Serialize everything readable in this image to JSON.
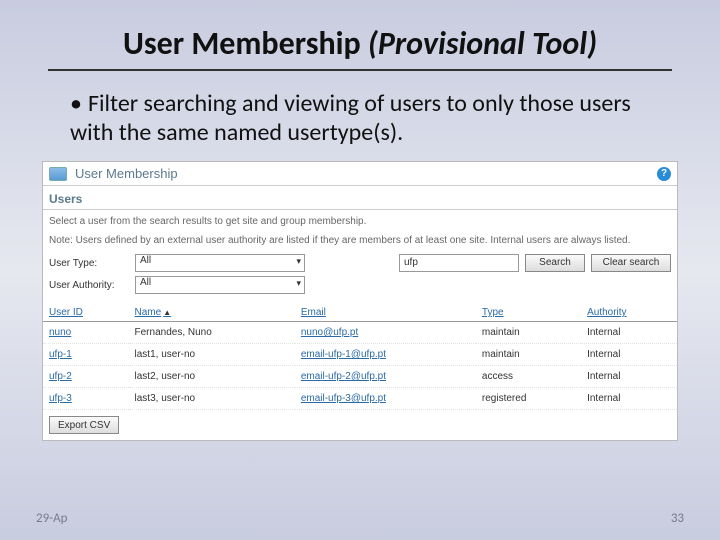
{
  "slide": {
    "title_main": "User Membership ",
    "title_ital": "(Provisional Tool)",
    "bullet": "Filter searching and viewing of users to only those users with the same named usertype(s).",
    "footer_date": "29-Ap",
    "footer_page": "33"
  },
  "panel": {
    "header": "User Membership",
    "help": "?",
    "section": "Users",
    "desc": "Select a user from the search results to get site and group membership.",
    "note": "Note: Users defined by an external user authority are listed if they are members of at least one site. Internal users are always listed.",
    "labels": {
      "user_type": "User Type:",
      "user_authority": "User Authority:"
    },
    "selects": {
      "user_type": "All",
      "user_authority": "All"
    },
    "search_value": "ufp",
    "buttons": {
      "search": "Search",
      "clear": "Clear search",
      "export": "Export CSV"
    },
    "columns": {
      "user_id": "User ID",
      "name": "Name",
      "email": "Email",
      "type": "Type",
      "authority": "Authority"
    },
    "sort_icon": "▲",
    "rows": [
      {
        "user_id": "nuno",
        "name": "Fernandes, Nuno",
        "email": "nuno@ufp.pt",
        "type": "maintain",
        "authority": "Internal"
      },
      {
        "user_id": "ufp-1",
        "name": "last1, user-no",
        "email": "email-ufp-1@ufp.pt",
        "type": "maintain",
        "authority": "Internal"
      },
      {
        "user_id": "ufp-2",
        "name": "last2, user-no",
        "email": "email-ufp-2@ufp.pt",
        "type": "access",
        "authority": "Internal"
      },
      {
        "user_id": "ufp-3",
        "name": "last3, user-no",
        "email": "email-ufp-3@ufp.pt",
        "type": "registered",
        "authority": "Internal"
      }
    ]
  }
}
